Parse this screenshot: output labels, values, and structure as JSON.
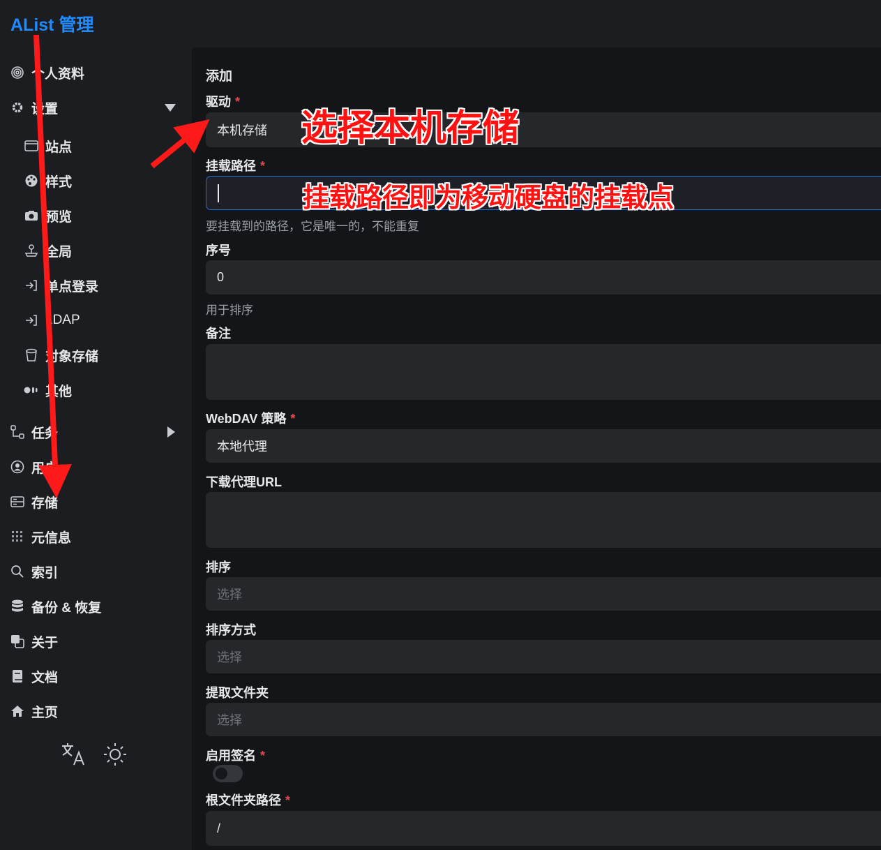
{
  "header": {
    "brand": "AList 管理"
  },
  "sidebar": {
    "items": [
      {
        "label": "个人资料",
        "icon": "fingerprint-icon"
      },
      {
        "label": "设置",
        "icon": "gear-icon"
      },
      {
        "label": "站点",
        "icon": "window-icon"
      },
      {
        "label": "样式",
        "icon": "palette-icon"
      },
      {
        "label": "预览",
        "icon": "camera-icon"
      },
      {
        "label": "全局",
        "icon": "joystick-icon"
      },
      {
        "label": "单点登录",
        "icon": "login-icon"
      },
      {
        "label": "LDAP",
        "icon": "login-icon"
      },
      {
        "label": "对象存储",
        "icon": "bucket-icon"
      },
      {
        "label": "其他",
        "icon": "dots-icon"
      },
      {
        "label": "任务",
        "icon": "flow-icon"
      },
      {
        "label": "用户",
        "icon": "user-circle-icon"
      },
      {
        "label": "存储",
        "icon": "storage-icon"
      },
      {
        "label": "元信息",
        "icon": "grid-icon"
      },
      {
        "label": "索引",
        "icon": "search-icon"
      },
      {
        "label": "备份 & 恢复",
        "icon": "database-icon"
      },
      {
        "label": "关于",
        "icon": "copy-icon"
      },
      {
        "label": "文档",
        "icon": "book-icon"
      },
      {
        "label": "主页",
        "icon": "home-icon"
      }
    ],
    "footer": {
      "language_icon": "translate-icon",
      "theme_icon": "sun-icon"
    }
  },
  "form": {
    "title": "添加",
    "driver": {
      "label": "驱动",
      "value": "本机存储"
    },
    "mount_path": {
      "label": "挂载路径",
      "value": "",
      "help": "要挂载到的路径，它是唯一的，不能重复"
    },
    "order": {
      "label": "序号",
      "value": "0",
      "help": "用于排序"
    },
    "remark": {
      "label": "备注",
      "value": ""
    },
    "webdav_policy": {
      "label": "WebDAV 策略",
      "value": "本地代理"
    },
    "download_proxy_url": {
      "label": "下载代理URL",
      "value": ""
    },
    "order_by": {
      "label": "排序",
      "placeholder": "选择"
    },
    "order_direction": {
      "label": "排序方式",
      "placeholder": "选择"
    },
    "extract_folder": {
      "label": "提取文件夹",
      "placeholder": "选择"
    },
    "enable_sign": {
      "label": "启用签名",
      "value": false
    },
    "root_folder_path": {
      "label": "根文件夹路径",
      "value": "/"
    },
    "required_mark": "*"
  },
  "annotations": {
    "driver_note": "选择本机存储",
    "mount_note": "挂载路径即为移动硬盘的挂载点"
  },
  "colors": {
    "accent": "#1f8bff",
    "required": "#e5484d",
    "annotation": "#ff1111"
  }
}
